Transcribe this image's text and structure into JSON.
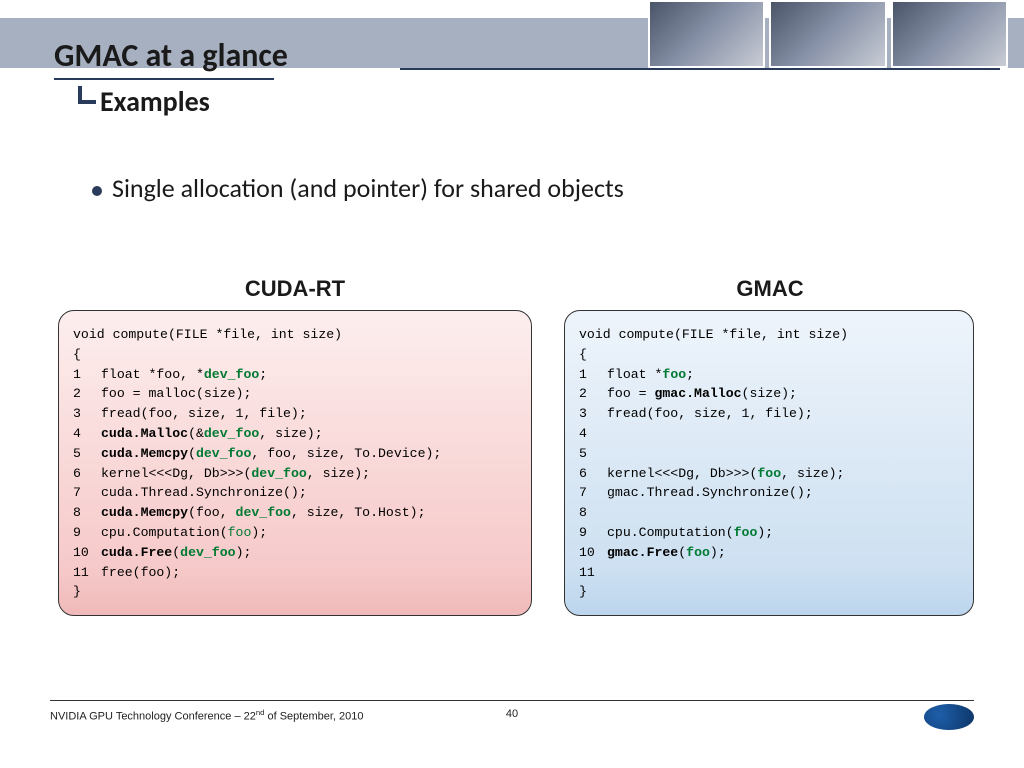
{
  "title": "GMAC at a glance",
  "subtitle": "Examples",
  "bullet": "Single allocation (and pointer) for shared objects",
  "headings": {
    "left": "CUDA-RT",
    "right": "GMAC"
  },
  "cuda": {
    "sig": "void compute(FILE *file, int size)",
    "l1a": "float *foo, *",
    "l1b": "dev_foo",
    "l1c": ";",
    "l2": "foo = malloc(size);",
    "l3": "fread(foo, size, 1, file);",
    "l4a": "cuda.Malloc",
    "l4b": "(&",
    "l4c": "dev_foo",
    "l4d": ", size);",
    "l5a": "cuda.Memcpy",
    "l5b": "(",
    "l5c": "dev_foo",
    "l5d": ", foo, size, To.Device);",
    "l6a": "kernel<<<Dg, Db>>>(",
    "l6b": "dev_foo",
    "l6c": ", size);",
    "l7": "cuda.Thread.Synchronize();",
    "l8a": "cuda.Memcpy",
    "l8b": "(foo, ",
    "l8c": "dev_foo",
    "l8d": ", size, To.Host);",
    "l9a": "cpu.Computation(",
    "l9b": "foo",
    "l9c": ");",
    "l10a": "cuda.Free",
    "l10b": "(",
    "l10c": "dev_foo",
    "l10d": ");",
    "l11": "free(foo);"
  },
  "gmac": {
    "sig": "void compute(FILE *file, int size)",
    "l1a": "float *",
    "l1b": "foo",
    "l1c": ";",
    "l2a": "foo = ",
    "l2b": "gmac.Malloc",
    "l2c": "(size);",
    "l3": "fread(foo, size, 1, file);",
    "l6a": "kernel<<<Dg, Db>>>(",
    "l6b": "foo",
    "l6c": ", size);",
    "l7": "gmac.Thread.Synchronize();",
    "l9a": "cpu.Computation(",
    "l9b": "foo",
    "l9c": ");",
    "l10a": "gmac.Free",
    "l10b": "(",
    "l10c": "foo",
    "l10d": ");"
  },
  "footer": {
    "left_pre": "NVIDIA GPU Technology Conference – 22",
    "left_sup": "nd",
    "left_post": " of September, 2010",
    "page": "40"
  }
}
